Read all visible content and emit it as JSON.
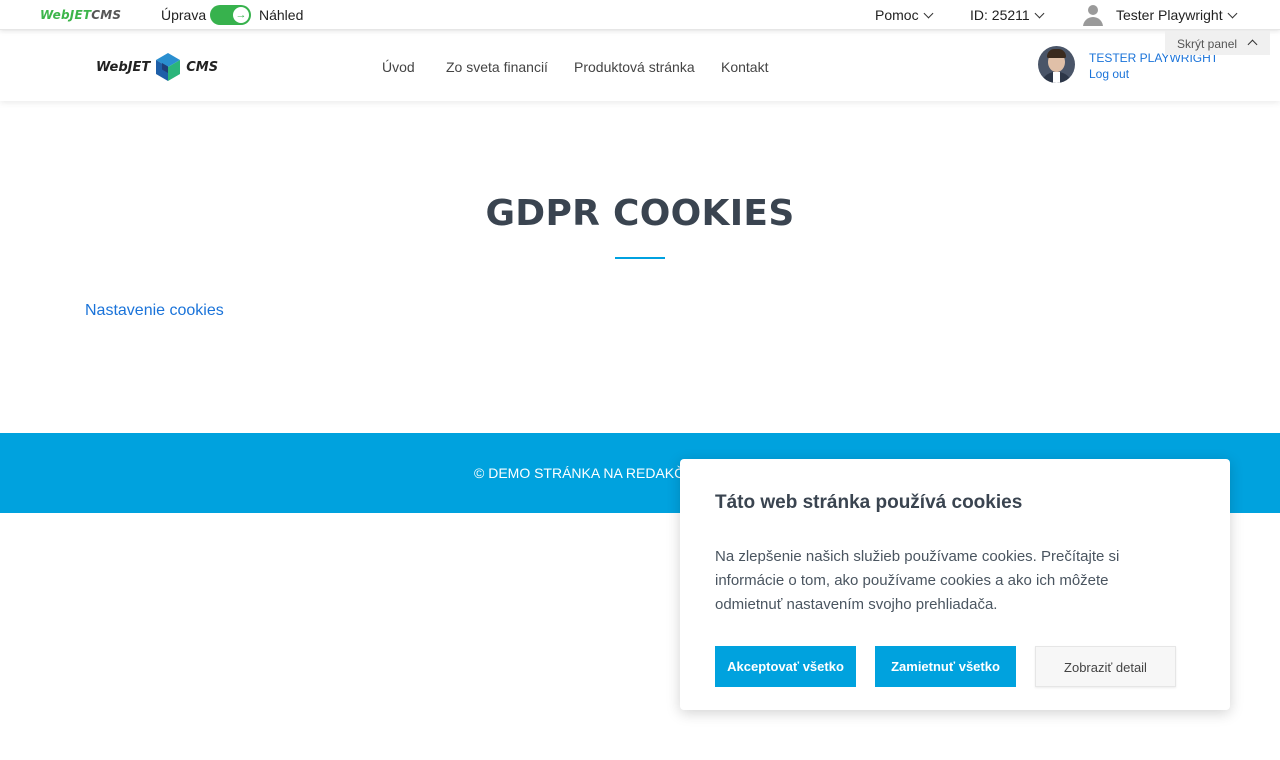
{
  "adminbar": {
    "logo_green": "WebJET",
    "logo_gray": "CMS",
    "edit_label": "Úprava",
    "preview_label": "Náhled",
    "help_label": "Pomoc",
    "page_id": "ID: 25211",
    "user_name": "Tester Playwright",
    "hide_panel_label": "Skrýt panel"
  },
  "header": {
    "logo_left": "WebJET",
    "logo_right": "CMS",
    "nav": [
      "Úvod",
      "Zo sveta financií",
      "Produktová stránka",
      "Kontakt"
    ],
    "profile_name": "TESTER PLAYWRIGHT",
    "logout_label": "Log out"
  },
  "main": {
    "title": "GDPR COOKIES",
    "cookie_link": "Nastavenie cookies"
  },
  "footer": {
    "text": "© DEMO STRÁNKA NA REDAKČNÝ SYSTÉM WEBJET CMS"
  },
  "cookie_dialog": {
    "title": "Táto web stránka používá cookies",
    "text": "Na zlepšenie našich služieb používame cookies. Prečítajte si informácie o tom, ako používame cookies a ako ich môžete odmietnuť nastavením svojho prehliadača.",
    "accept_label": "Akceptovať všetko",
    "reject_label": "Zamietnuť všetko",
    "detail_label": "Zobraziť detail"
  },
  "colors": {
    "accent": "#00a2de",
    "toggle_on": "#37b24d",
    "link": "#1a73d9"
  }
}
